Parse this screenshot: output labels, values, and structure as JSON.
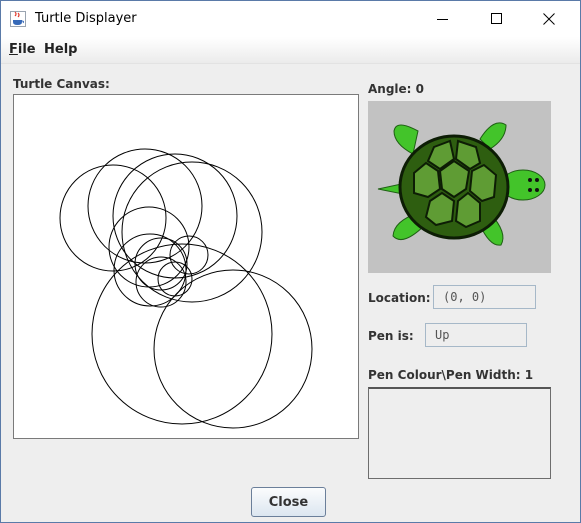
{
  "window": {
    "title": "Turtle Displayer"
  },
  "menu": [
    {
      "label": "File",
      "mnemonic": "F",
      "rest": "ile"
    },
    {
      "label": "Help"
    }
  ],
  "canvas": {
    "label": "Turtle Canvas:"
  },
  "angle": {
    "label": "Angle: 0"
  },
  "location": {
    "label": "Location:",
    "value": "(0, 0)"
  },
  "pen": {
    "label": "Pen is:",
    "value": "Up"
  },
  "pen_colour": {
    "label": "Pen Colour\\Pen Width: 1"
  },
  "buttons": {
    "close": "Close"
  },
  "colors": {
    "turtle_shell": "#2e5e10",
    "turtle_skin": "#43c42a",
    "image_bg": "#c2c2c2"
  },
  "icons": {
    "app": "java-icon",
    "turtle": "turtle-image"
  }
}
